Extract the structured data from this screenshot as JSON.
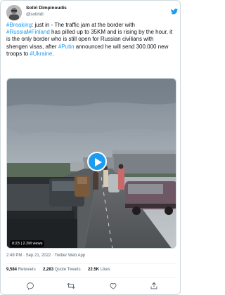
{
  "author": {
    "name": "Sotiri Dimpinoudis",
    "handle": "@sotiridi"
  },
  "tweet": {
    "segments": [
      {
        "text": "#Breaking",
        "link": true
      },
      {
        "text": ": just in - The traffic jam at the border with ",
        "link": false
      },
      {
        "text": "#Russia",
        "link": true
      },
      {
        "text": "/",
        "link": false
      },
      {
        "text": "#Finland",
        "link": true
      },
      {
        "text": " has pilled up to 35KM and is rising by the hour, it is the only border who is still open for Russian civilians with shengen visas, after ",
        "link": false
      },
      {
        "text": "#Putin",
        "link": true
      },
      {
        "text": " announced he will send 300.000 new troops to ",
        "link": false
      },
      {
        "text": "#Ukraine",
        "link": true
      },
      {
        "text": ".",
        "link": false
      }
    ]
  },
  "video": {
    "duration_label": "0:23 | 2.2M views"
  },
  "meta": {
    "timestamp": "2:49 PM · Sep 21, 2022 · Twitter Web App"
  },
  "stats": {
    "retweets_count": "9,584",
    "retweets_label": "Retweets",
    "quotes_count": "2,283",
    "quotes_label": "Quote Tweets",
    "likes_count": "22.5K",
    "likes_label": "Likes"
  },
  "icons": {
    "brand": "twitter-bird-icon",
    "actions": [
      "reply-icon",
      "retweet-icon",
      "like-icon",
      "share-icon"
    ]
  },
  "colors": {
    "link": "#1d9bf0",
    "text": "#0f1419",
    "secondary": "#536471",
    "border": "#cfd9de"
  }
}
